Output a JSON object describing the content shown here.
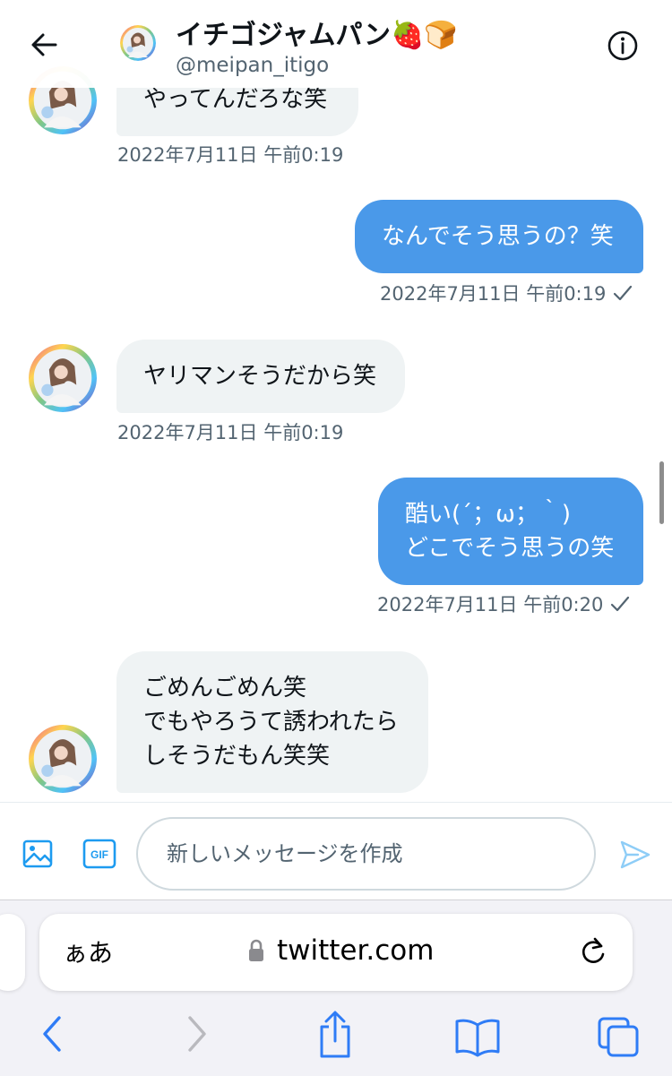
{
  "header": {
    "display_name": "イチゴジャムパン🍓🍞",
    "handle": "@meipan_itigo"
  },
  "messages": [
    {
      "side": "in",
      "text": "やってんだろな笑",
      "timestamp": "2022年7月11日 午前0:19"
    },
    {
      "side": "out",
      "text": "なんでそう思うの？笑",
      "timestamp": "2022年7月11日 午前0:19",
      "read": true
    },
    {
      "side": "in",
      "text": "ヤリマンそうだから笑",
      "timestamp": "2022年7月11日 午前0:19"
    },
    {
      "side": "out",
      "text": "酷い(´；ω；｀)\nどこでそう思うの笑",
      "timestamp": "2022年7月11日 午前0:20",
      "read": true
    },
    {
      "side": "in",
      "text": "ごめんごめん笑\nでもやろうて誘われたら\nしそうだもん笑笑"
    }
  ],
  "compose": {
    "placeholder": "新しいメッセージを作成",
    "gif_label": "GIF"
  },
  "browser": {
    "aa_label": "ぁあ",
    "url": "twitter.com"
  },
  "colors": {
    "accent": "#1d9bf0",
    "outgoing_bubble": "#4a99e9",
    "incoming_bubble": "#eff3f4",
    "timestamp": "#536471",
    "safari_tint": "#2f7cf6"
  }
}
